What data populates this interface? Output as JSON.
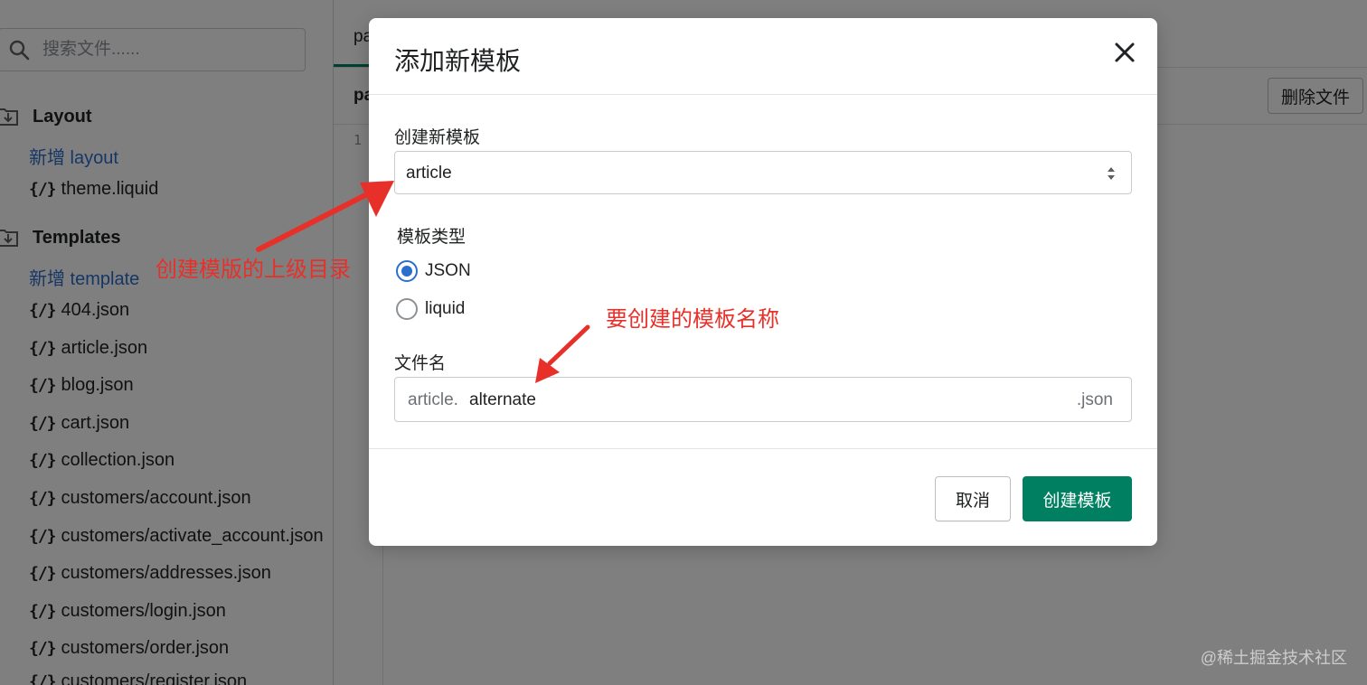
{
  "sidebar": {
    "search_placeholder": "搜索文件......",
    "layout_section": {
      "title": "Layout",
      "add_label": "新增 layout",
      "files": [
        "theme.liquid"
      ]
    },
    "templates_section": {
      "title": "Templates",
      "add_label": "新增 template",
      "files": [
        "404.json",
        "article.json",
        "blog.json",
        "cart.json",
        "collection.json",
        "customers/account.json",
        "customers/activate_account.json",
        "customers/addresses.json",
        "customers/login.json",
        "customers/order.json",
        "customers/register.json"
      ]
    },
    "code_icon_glyph": "{/}"
  },
  "editor": {
    "tab_label": "pa",
    "toolbar_label": "pa",
    "delete_label": "删除文件",
    "line_number": "1"
  },
  "modal": {
    "title": "添加新模板",
    "create_from_label": "创建新模板",
    "create_from_value": "article",
    "type_label": "模板类型",
    "type_options": [
      {
        "label": "JSON",
        "checked": true
      },
      {
        "label": "liquid",
        "checked": false
      }
    ],
    "filename_label": "文件名",
    "filename_prefix": "article.",
    "filename_value": "alternate",
    "filename_suffix": ".json",
    "cancel_label": "取消",
    "create_label": "创建模板"
  },
  "annotations": {
    "parent_dir": "创建模版的上级目录",
    "template_name": "要创建的模板名称"
  },
  "watermark": "@稀土掘金技术社区",
  "colors": {
    "primary": "#008060",
    "link": "#2c6ecb",
    "annotation": "#e8302a"
  }
}
